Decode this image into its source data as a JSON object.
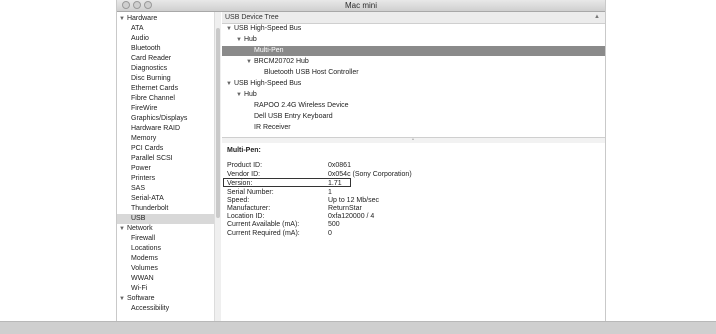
{
  "window": {
    "title": "Mac mini"
  },
  "sidebar": {
    "hardware": {
      "label": "Hardware",
      "items": [
        "ATA",
        "Audio",
        "Bluetooth",
        "Card Reader",
        "Diagnostics",
        "Disc Burning",
        "Ethernet Cards",
        "Fibre Channel",
        "FireWire",
        "Graphics/Displays",
        "Hardware RAID",
        "Memory",
        "PCI Cards",
        "Parallel SCSI",
        "Power",
        "Printers",
        "SAS",
        "Serial-ATA",
        "Thunderbolt",
        "USB"
      ]
    },
    "network": {
      "label": "Network",
      "items": [
        "Firewall",
        "Locations",
        "Modems",
        "Volumes",
        "WWAN",
        "Wi-Fi"
      ]
    },
    "software": {
      "label": "Software",
      "items": [
        "Accessibility"
      ]
    },
    "selected": "USB"
  },
  "tree": {
    "header": "USB Device Tree",
    "rows": [
      {
        "label": "USB High-Speed Bus",
        "level": 0,
        "toggle": true
      },
      {
        "label": "Hub",
        "level": 1,
        "toggle": true
      },
      {
        "label": "Multi-Pen",
        "level": 2,
        "toggle": false,
        "selected": true
      },
      {
        "label": "BRCM20702 Hub",
        "level": 2,
        "toggle": true
      },
      {
        "label": "Bluetooth USB Host Controller",
        "level": 3,
        "toggle": false
      },
      {
        "label": "USB High-Speed Bus",
        "level": 0,
        "toggle": true
      },
      {
        "label": "Hub",
        "level": 1,
        "toggle": true
      },
      {
        "label": "RAPOO 2.4G Wireless Device",
        "level": 2,
        "toggle": false
      },
      {
        "label": "Dell USB Entry Keyboard",
        "level": 2,
        "toggle": false
      },
      {
        "label": "IR Receiver",
        "level": 2,
        "toggle": false
      }
    ]
  },
  "detail": {
    "title": "Multi-Pen:",
    "properties": [
      {
        "key": "Product ID:",
        "value": "0x0861"
      },
      {
        "key": "Vendor ID:",
        "value": "0x054c  (Sony Corporation)"
      },
      {
        "key": "Version:",
        "value": "1.71"
      },
      {
        "key": "Serial Number:",
        "value": "1"
      },
      {
        "key": "Speed:",
        "value": "Up to 12 Mb/sec"
      },
      {
        "key": "Manufacturer:",
        "value": "ReturnStar"
      },
      {
        "key": "Location ID:",
        "value": "0xfa120000 / 4"
      },
      {
        "key": "Current Available (mA):",
        "value": "500"
      },
      {
        "key": "Current Required (mA):",
        "value": "0"
      }
    ],
    "highlighted_key": "Version:"
  }
}
